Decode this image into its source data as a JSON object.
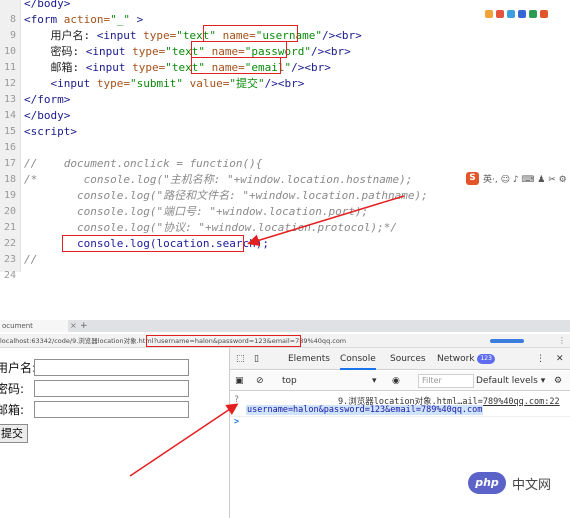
{
  "editor": {
    "lines": [
      {
        "no": "",
        "parts": [
          {
            "c": "tg",
            "t": "</body>"
          }
        ]
      },
      {
        "no": "8",
        "parts": [
          {
            "c": "tg",
            "t": "<form "
          },
          {
            "c": "at",
            "t": "action="
          },
          {
            "c": "st",
            "t": "\"_\""
          },
          {
            "c": "tg",
            "t": " >"
          }
        ]
      },
      {
        "no": "9",
        "parts": [
          {
            "c": "tx",
            "t": "    用户名: "
          },
          {
            "c": "tg",
            "t": "<input "
          },
          {
            "c": "at",
            "t": "type="
          },
          {
            "c": "st",
            "t": "\"text\" "
          },
          {
            "c": "at",
            "t": "name="
          },
          {
            "c": "st",
            "t": "\"username\""
          },
          {
            "c": "tg",
            "t": "/><br>"
          }
        ]
      },
      {
        "no": "10",
        "parts": [
          {
            "c": "tx",
            "t": "    密码: "
          },
          {
            "c": "tg",
            "t": "<input "
          },
          {
            "c": "at",
            "t": "type="
          },
          {
            "c": "st",
            "t": "\"text\" "
          },
          {
            "c": "at",
            "t": "name="
          },
          {
            "c": "st",
            "t": "\"password\""
          },
          {
            "c": "tg",
            "t": "/><br>"
          }
        ]
      },
      {
        "no": "11",
        "parts": [
          {
            "c": "tx",
            "t": "    邮箱: "
          },
          {
            "c": "tg",
            "t": "<input "
          },
          {
            "c": "at",
            "t": "type="
          },
          {
            "c": "st",
            "t": "\"text\" "
          },
          {
            "c": "at",
            "t": "name="
          },
          {
            "c": "st",
            "t": "\"email\""
          },
          {
            "c": "tg",
            "t": "/><br>"
          }
        ]
      },
      {
        "no": "12",
        "parts": [
          {
            "c": "tg",
            "t": "    <input "
          },
          {
            "c": "at",
            "t": "type="
          },
          {
            "c": "st",
            "t": "\"submit\" "
          },
          {
            "c": "at",
            "t": "value="
          },
          {
            "c": "st",
            "t": "\"提交\""
          },
          {
            "c": "tg",
            "t": "/><br>"
          }
        ]
      },
      {
        "no": "13",
        "parts": [
          {
            "c": "tg",
            "t": "</form>"
          }
        ]
      },
      {
        "no": "14",
        "parts": [
          {
            "c": "tg",
            "t": "</body>"
          }
        ]
      },
      {
        "no": "15",
        "parts": [
          {
            "c": "tg",
            "t": "<script>"
          }
        ]
      },
      {
        "no": "16",
        "parts": []
      },
      {
        "no": "17",
        "parts": [
          {
            "c": "cm",
            "t": "//    document.onclick = function(){"
          }
        ]
      },
      {
        "no": "18",
        "parts": [
          {
            "c": "cm",
            "t": "/*       console.log(\"主机名称: \"+window.location.hostname);"
          }
        ]
      },
      {
        "no": "19",
        "parts": [
          {
            "c": "cm",
            "t": "        console.log(\"路径和文件名: \"+window.location.pathname);"
          }
        ]
      },
      {
        "no": "20",
        "parts": [
          {
            "c": "cm",
            "t": "        console.log(\"端口号: \"+window.location.port);"
          }
        ]
      },
      {
        "no": "21",
        "parts": [
          {
            "c": "cm",
            "t": "        console.log(\"协议: \"+window.location.protocol);*/"
          }
        ]
      },
      {
        "no": "22",
        "parts": [
          {
            "c": "tx",
            "t": "        "
          },
          {
            "c": "hl",
            "t": "console.log(location.search);"
          }
        ]
      },
      {
        "no": "23",
        "parts": [
          {
            "c": "cm",
            "t": "//"
          }
        ]
      },
      {
        "no": "24",
        "parts": []
      }
    ]
  },
  "ime": {
    "logo": "S",
    "tools": "英·, ☺ ♪ ⌨ ♟ ✂ ⚙"
  },
  "browser": {
    "tab_title": "ocument",
    "tab_close": "×",
    "tab_new": "+",
    "url": "localhost:63342/code/9.浏览器location对象.html?username=halon&password=123&email=789%40qq.com",
    "menu": "⋮"
  },
  "form": {
    "username_label": "用户名:",
    "password_label": "密码:",
    "email_label": "邮箱:",
    "submit_label": "提交"
  },
  "devtools": {
    "tabs": [
      "Elements",
      "Console",
      "Sources",
      "Network"
    ],
    "network_badge": "123",
    "context": "top",
    "filter_placeholder": "Filter",
    "levels": "Default levels ▾",
    "source_link": "9.浏览器location对象.html…ail=789%40qq.com:22",
    "log_marker": "?",
    "output": "username=halon&password=123&email=789%40qq.com",
    "prompt": ">"
  },
  "watermark": {
    "logo": "php",
    "text": "中文网"
  },
  "colors": {
    "annotation": "#e41f1f",
    "accent": "#1a73e8"
  }
}
